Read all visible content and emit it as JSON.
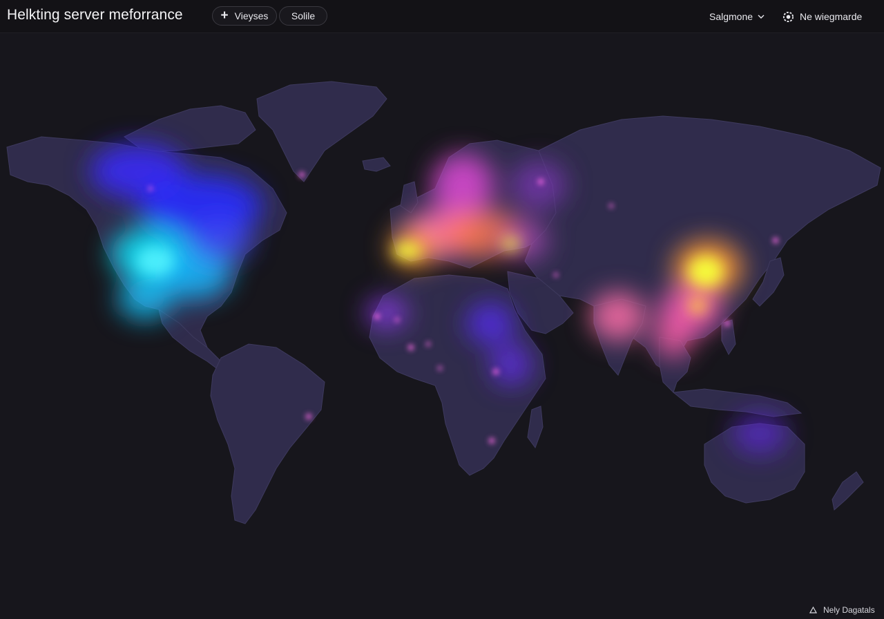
{
  "header": {
    "title": "Helkting server meforrance",
    "add_button_label": "Vieyses",
    "filter_button_label": "Solile",
    "selector_label": "Salgmone",
    "user_label": "Ne wiegmarde"
  },
  "footer": {
    "label": "Nely Dagatals"
  },
  "colors": {
    "background": "#17161c",
    "land": "#302c4c",
    "land_border": "#3e3a5e",
    "heat_low": "#2a2bff",
    "heat_mid_cyan": "#10d8f0",
    "heat_magenta": "#ff4fd8",
    "heat_orange": "#ff8a3d",
    "heat_high": "#f6ff3a"
  },
  "icons": {
    "add": "plus-icon",
    "selector": "chevron-down-icon",
    "user": "gear-user-icon",
    "footer": "triangle-icon"
  }
}
